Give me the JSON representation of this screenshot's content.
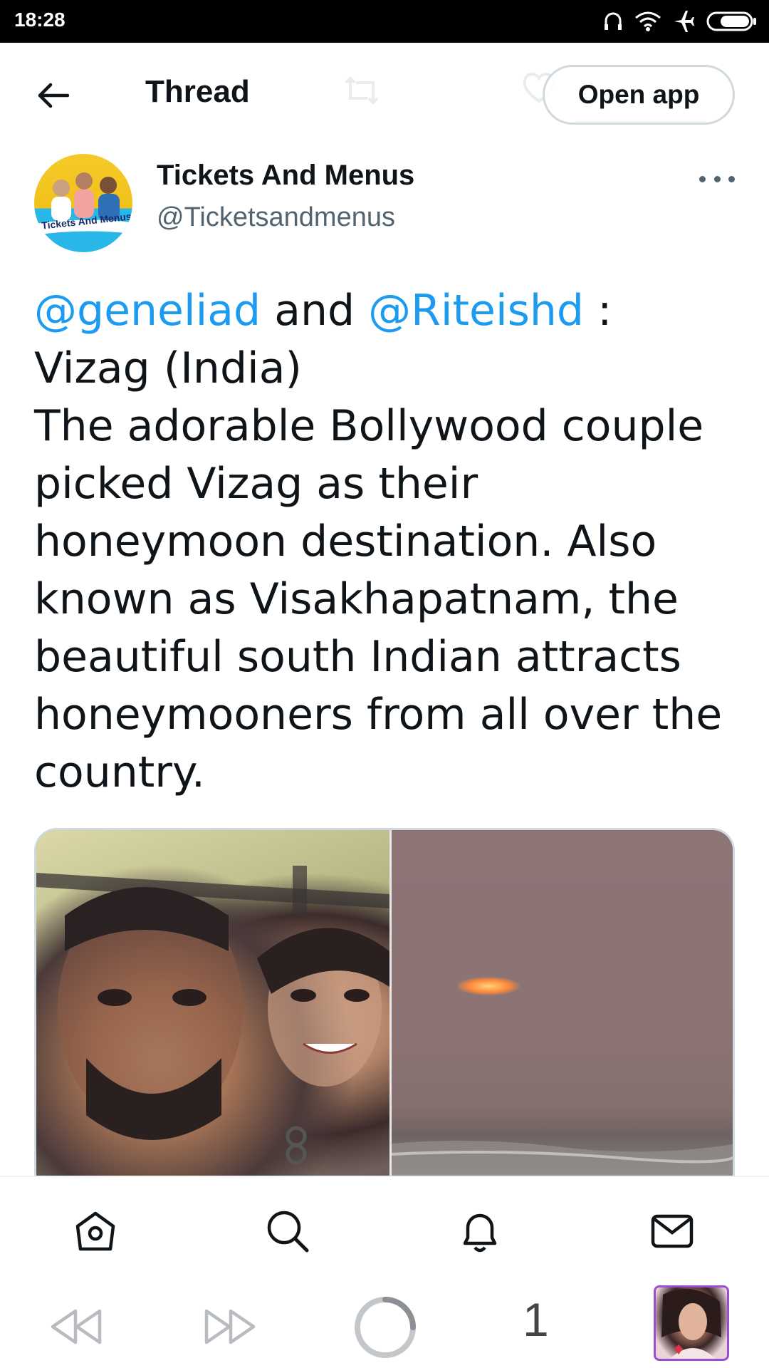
{
  "status_bar": {
    "time": "18:28",
    "icons": [
      "headphones-icon",
      "wifi-icon",
      "airplane-mode-icon",
      "battery-icon"
    ]
  },
  "header": {
    "title": "Thread",
    "open_app_label": "Open app",
    "back_icon": "arrow-left-icon"
  },
  "tweet": {
    "author_name": "Tickets And Menus",
    "author_handle": "@Ticketsandmenus",
    "avatar_label": "Tickets And Menus",
    "mention_1": "@geneliad",
    "text_and": " and ",
    "mention_2": "@Riteishd",
    "text_rest_1": " : Vizag (India)",
    "text_body": "The adorable Bollywood couple picked Vizag as their honeymoon destination. Also known as Visakhapatnam, the beautiful south Indian attracts honeymooners from all over the country."
  },
  "bottom_nav": {
    "items": [
      "home-icon",
      "search-icon",
      "notifications-icon",
      "messages-icon"
    ]
  },
  "browser_bar": {
    "tab_count": "1",
    "items": [
      "back-icon",
      "forward-icon",
      "loading-icon",
      "tabs-count",
      "tab-thumbnail"
    ]
  },
  "colors": {
    "mention": "#1d9bf0",
    "text": "#0f1419",
    "secondary": "#536471",
    "border": "#cfd9de"
  }
}
